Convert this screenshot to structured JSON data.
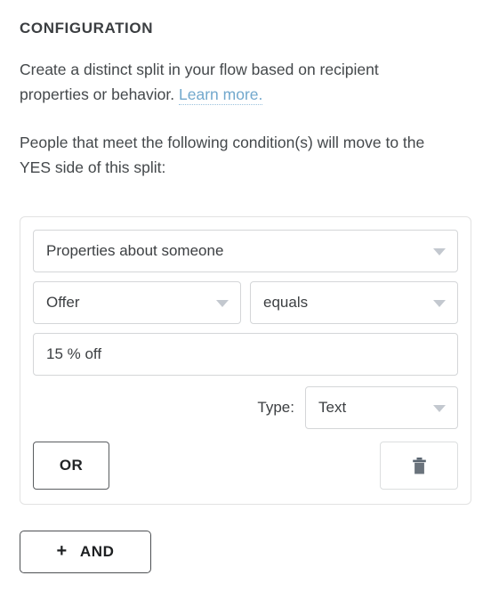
{
  "header": {
    "section_title": "CONFIGURATION",
    "description_text": "Create a distinct split in your flow based on recipient properties or behavior.",
    "learn_more_label": "Learn more.",
    "instruction_text": "People that meet the following condition(s) will move to the YES side of this split:"
  },
  "condition": {
    "subject_select": {
      "value": "Properties about someone",
      "icon": "chevron-down-icon"
    },
    "property_select": {
      "value": "Offer",
      "icon": "chevron-down-icon"
    },
    "operator_select": {
      "value": "equals",
      "icon": "chevron-down-icon"
    },
    "value_input": {
      "value": "15 % off",
      "placeholder": ""
    },
    "type_label": "Type:",
    "type_select": {
      "value": "Text",
      "icon": "chevron-down-icon"
    },
    "or_button_label": "OR",
    "delete_button": {
      "icon": "trash-icon"
    }
  },
  "footer": {
    "and_button": {
      "plus_glyph": "+",
      "label": "AND",
      "icon": "plus-icon"
    }
  },
  "colors": {
    "link": "#72a8cd",
    "text": "#3c3f42",
    "panel_border": "#e2e2e2",
    "field_border": "#d4d6d8",
    "caret": "#c3c8cf",
    "trash": "#5a6570"
  }
}
